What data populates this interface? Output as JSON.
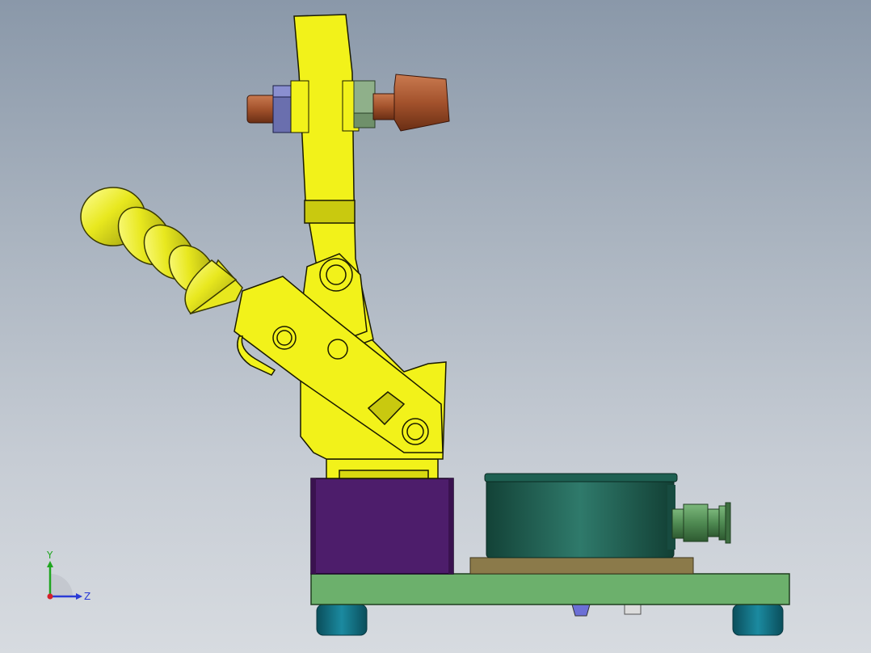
{
  "viewport": {
    "background_top": "#8a98a9",
    "background_bottom": "#d7dbe0"
  },
  "triad": {
    "y_label": "Y",
    "z_label": "Z",
    "y_color": "#1fa51f",
    "z_color": "#2a3bd6",
    "x_color": "#d6202a"
  },
  "model": {
    "clamp_color": "#f2f21a",
    "handle_color": "#e8e81e",
    "spindle_color": "#a3522c",
    "nut_left_color": "#6a6fae",
    "nut_right_color": "#8fb08a",
    "riser_block_color": "#4d1d6b",
    "base_plate_color": "#6cb06c",
    "cylinder_color": "#1f5b4f",
    "cylinder_pad_color": "#8b7a4a",
    "feet_color": "#0f6a7a",
    "fitting_color": "#4f8a52"
  }
}
